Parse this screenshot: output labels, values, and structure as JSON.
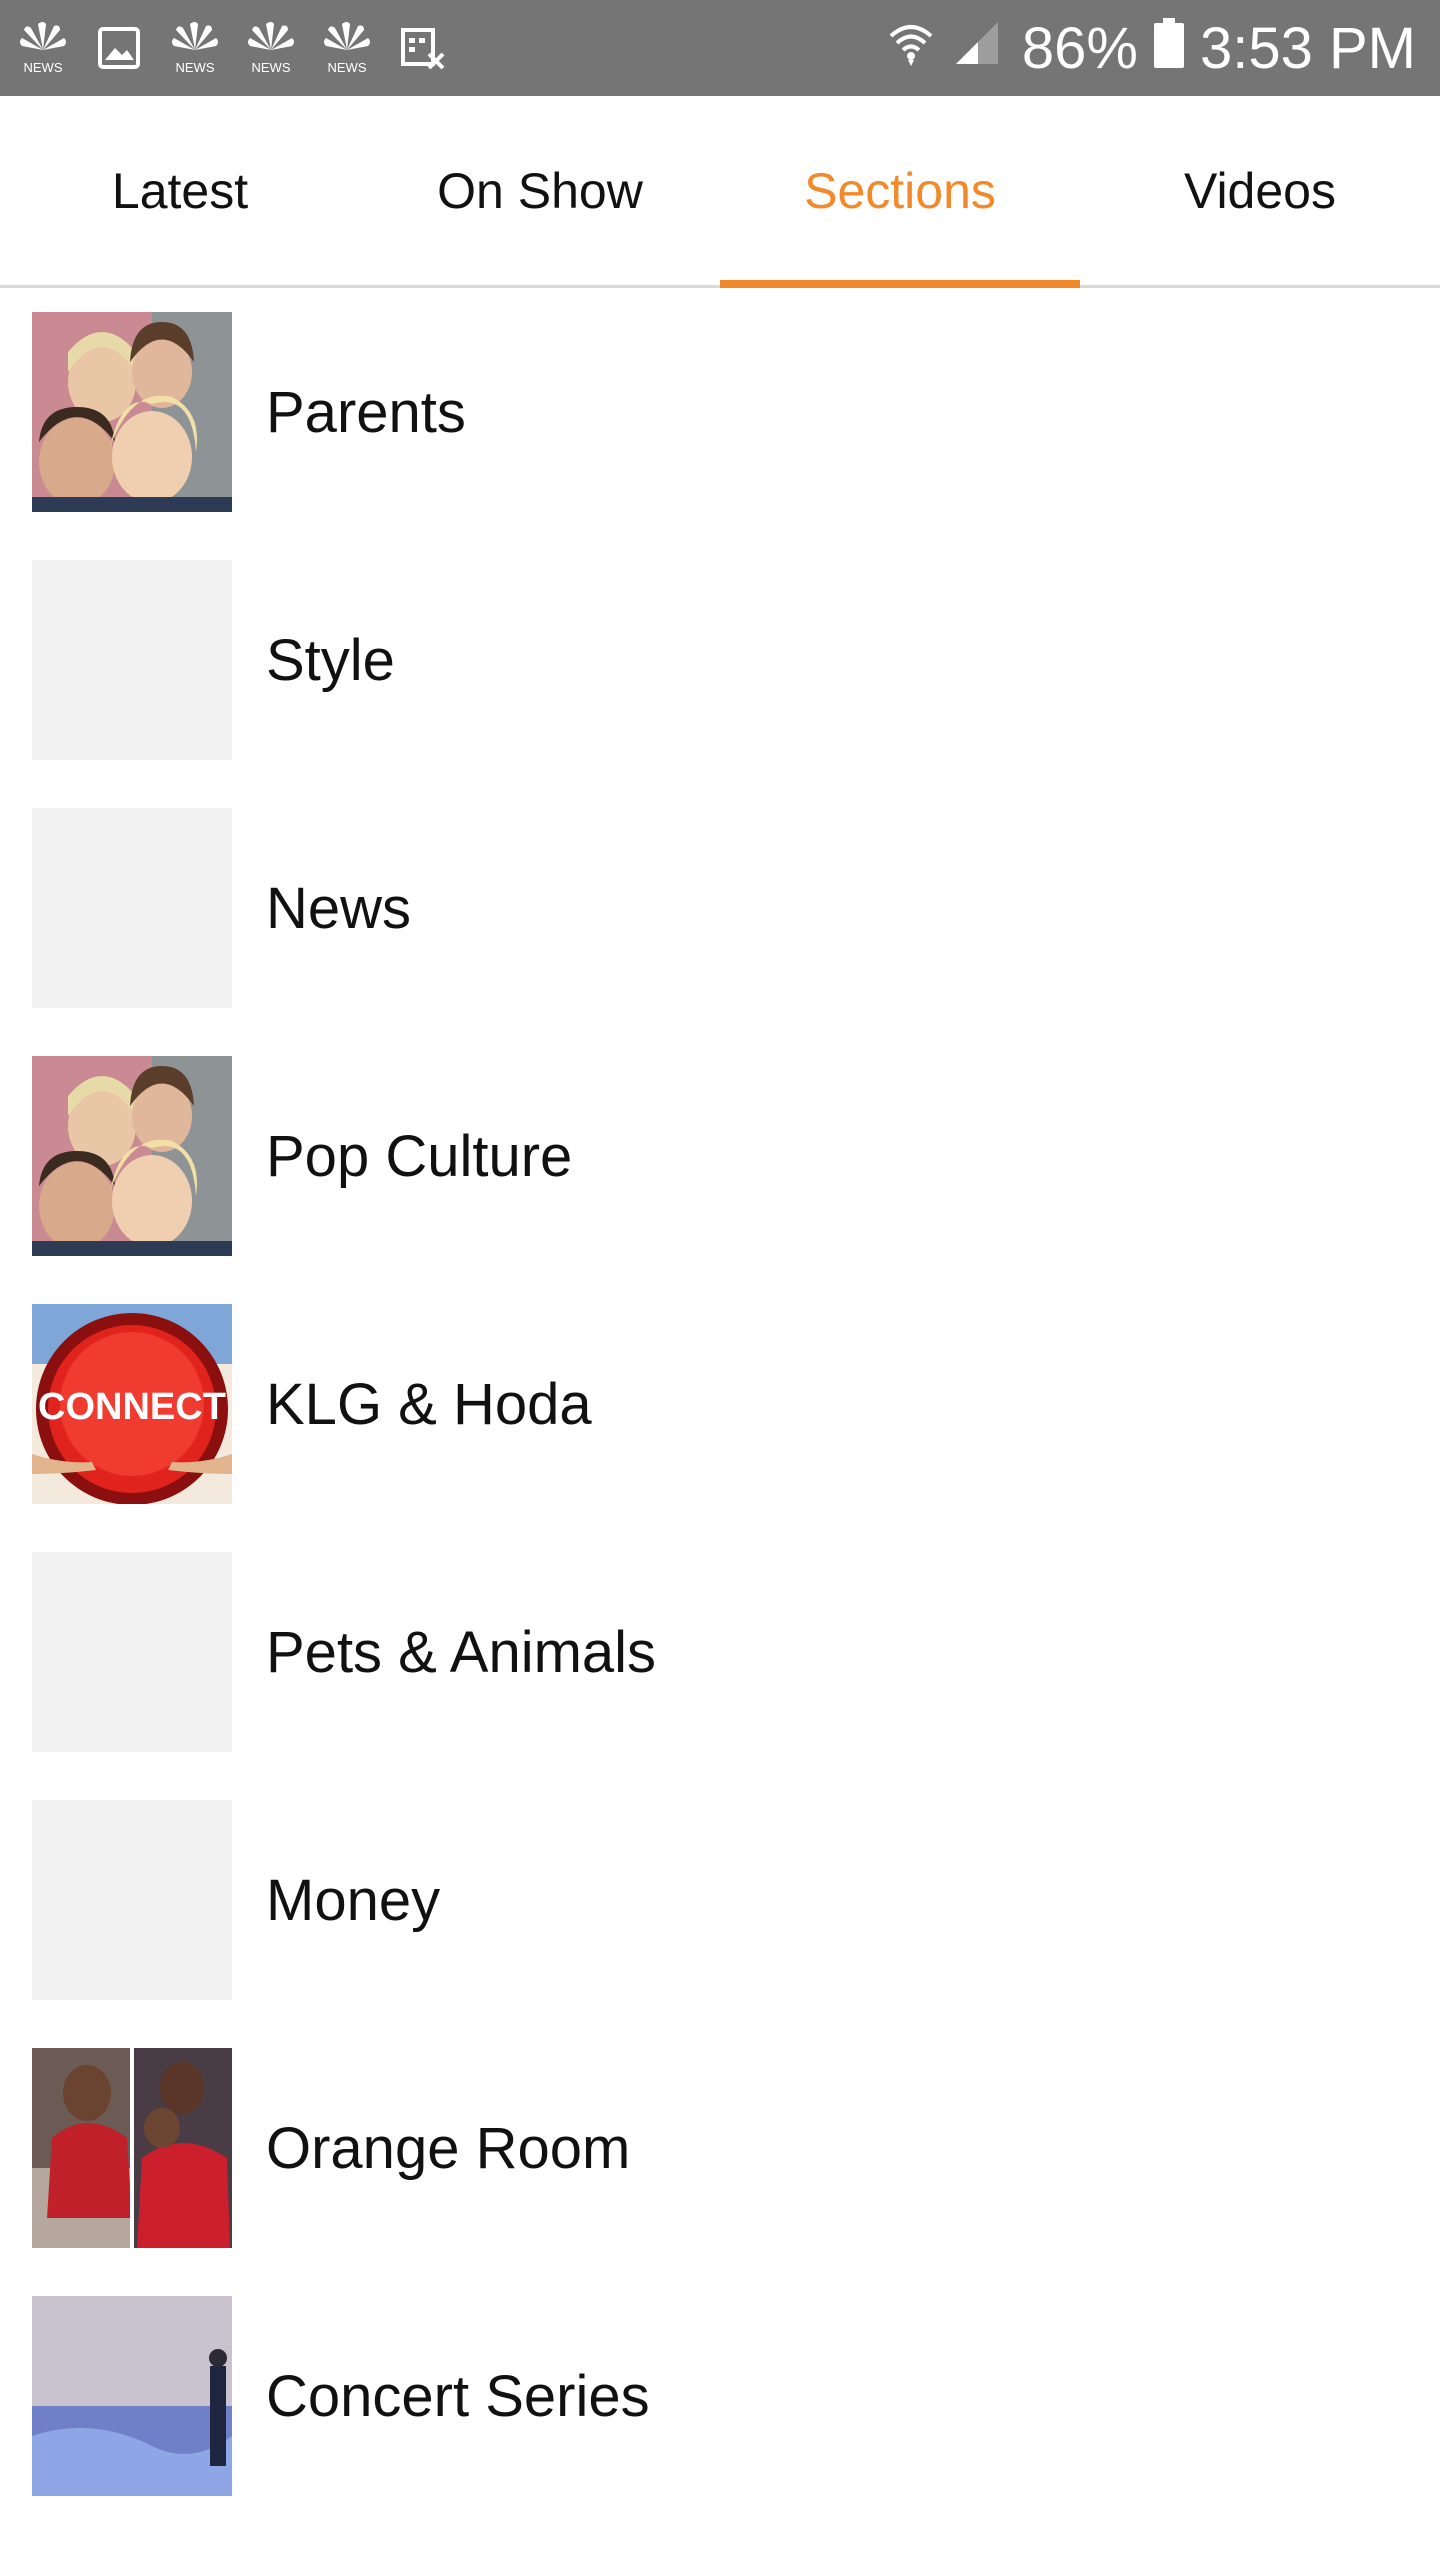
{
  "status_bar": {
    "left_icons": [
      "nbc-news-icon",
      "gallery-icon",
      "nbc-news-icon",
      "nbc-news-icon",
      "nbc-news-icon",
      "blocked-calendar-icon"
    ],
    "battery": "86%",
    "time": "3:53 PM",
    "background": "#757575"
  },
  "tabs": [
    {
      "label": "Latest",
      "active": false
    },
    {
      "label": "On Show",
      "active": false
    },
    {
      "label": "Sections",
      "active": true
    },
    {
      "label": "Videos",
      "active": false
    }
  ],
  "accent_color": "#f28a2b",
  "sections": [
    {
      "label": "Parents",
      "thumb": "family-photo"
    },
    {
      "label": "Style",
      "thumb": "blank"
    },
    {
      "label": "News",
      "thumb": "blank"
    },
    {
      "label": "Pop Culture",
      "thumb": "family-photo"
    },
    {
      "label": "KLG & Hoda",
      "thumb": "connect-button",
      "thumb_text": "CONNECT"
    },
    {
      "label": "Pets & Animals",
      "thumb": "blank"
    },
    {
      "label": "Money",
      "thumb": "blank"
    },
    {
      "label": "Orange Room",
      "thumb": "crowd-photo"
    },
    {
      "label": "Concert Series",
      "thumb": "stage-photo"
    }
  ]
}
